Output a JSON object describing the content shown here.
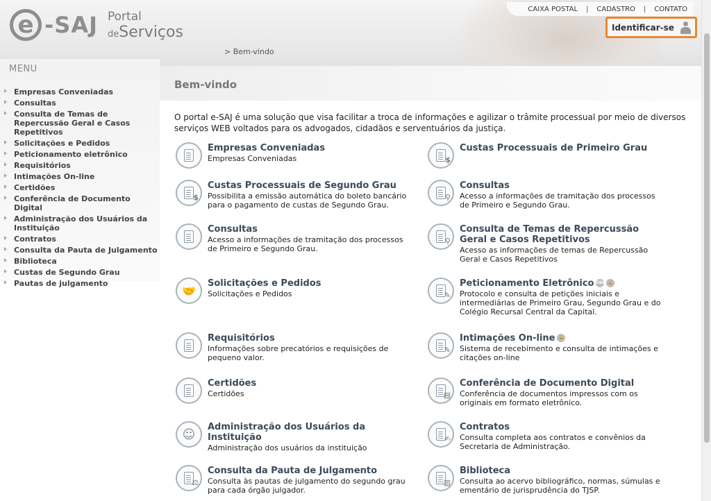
{
  "header": {
    "logo_e": "e",
    "logo_saj": "-SAJ",
    "logo_portal": "Portal",
    "logo_de": "de",
    "logo_servicos": "Serviços",
    "topnav": [
      "CAIXA POSTAL",
      "CADASTRO",
      "CONTATO"
    ],
    "separator": "|",
    "identify_label": "Identificar-se",
    "breadcrumb": "> Bem-vindo"
  },
  "sidebar": {
    "title": "MENU",
    "items": [
      "Empresas Conveniadas",
      "Consultas",
      "Consulta de Temas de Repercussão Geral e Casos Repetitivos",
      "Solicitações e Pedidos",
      "Peticionamento eletrônico",
      "Requisitórios",
      "Intimações On-line",
      "Certidões",
      "Conferência de Documento Digital",
      "Administração dos Usuários da Instituição",
      "Contratos",
      "Consulta da Pauta de Julgamento",
      "Biblioteca",
      "Custas de Segundo Grau",
      "Pautas de julgamento"
    ]
  },
  "main": {
    "title": "Bem-vindo",
    "intro": "O portal e-SAJ é uma solução que visa facilitar a troca de informações e agilizar o trâmite processual por meio de diversos serviços WEB voltados para os advogados, cidadãos e serventuários da justiça.",
    "services": [
      {
        "title": "Empresas Conveniadas",
        "desc": "Empresas Conveniadas",
        "icon": "document-icon",
        "glyph": ""
      },
      {
        "title": "Custas Processuais de Primeiro Grau",
        "desc": "",
        "icon": "boleto-icon",
        "glyph": "$"
      },
      {
        "title": "Custas Processuais de Segundo Grau",
        "desc": "Possibilita a emissão automática do boleto bancário para o pagamento de custas de Segundo Grau.",
        "icon": "boleto-icon",
        "glyph": "$"
      },
      {
        "title": "Consultas",
        "desc": "Acesso a informações de tramitação dos processos de Primeiro e Segundo Grau.",
        "icon": "magnifier-document-icon",
        "glyph": "⚲"
      },
      {
        "title": "Consultas",
        "desc": "Acesso a informações de tramitação dos processos de Primeiro e Segundo Grau.",
        "icon": "document-icon",
        "glyph": ""
      },
      {
        "title": "Consulta de Temas de Repercussão Geral e Casos Repetitivos",
        "desc": "Acesso as informações de temas de Repercussão Geral e Casos Repetitivos",
        "icon": "magnifier-document-icon",
        "glyph": "⚲"
      },
      {
        "title": "Solicitações e Pedidos",
        "desc": "Solicitações e Pedidos",
        "icon": "handshake-icon",
        "glyph": ""
      },
      {
        "title": "Peticionamento Eletrônico",
        "desc": "Protocolo e consulta de petições iniciais e intermediárias de Primeiro Grau, Segundo Grau e do Colégio Recursal Central da Capital.",
        "icon": "pen-document-icon",
        "glyph": "✎",
        "badges": [
          "OAB",
          "🔒"
        ]
      },
      {
        "title": "Requisitórios",
        "desc": "Informações sobre precatórios e requisições de pequeno valor.",
        "icon": "document-icon",
        "glyph": ""
      },
      {
        "title": "Intimações On-line",
        "desc": "Sistema de recebimento e consulta de intimações e citações on-line",
        "icon": "pen-document-icon",
        "glyph": "✎",
        "badges": [
          "🔒"
        ]
      },
      {
        "title": "Certidões",
        "desc": "Certidões",
        "icon": "document-icon",
        "glyph": ""
      },
      {
        "title": "Conferência de Documento Digital",
        "desc": "Conferência de documentos impressos com os originais em formato eletrônico.",
        "icon": "stacked-documents-icon",
        "glyph": "▤"
      },
      {
        "title": "Administração dos Usuários da Instituição",
        "desc": "Administração dos usuários da instituição",
        "icon": "user-icon",
        "glyph": "☺"
      },
      {
        "title": "Contratos",
        "desc": "Consulta completa aos contratos e convênios da Secretaria de Administração.",
        "icon": "contract-icon",
        "glyph": "✍"
      },
      {
        "title": "Consulta da Pauta de Julgamento",
        "desc": "Consulta às pautas de julgamento do segundo grau para cada órgão julgador.",
        "icon": "gavel-document-icon",
        "glyph": "⚖"
      },
      {
        "title": "Biblioteca",
        "desc": "Consulta ao acervo bibliográfico, normas, súmulas e ementário de jurisprudência do TJSP.",
        "icon": "book-icon",
        "glyph": "▥"
      }
    ]
  },
  "colors": {
    "highlight_border": "#e8882e",
    "title_text": "#3b4a5a",
    "icon_border": "#a9b3bd"
  }
}
